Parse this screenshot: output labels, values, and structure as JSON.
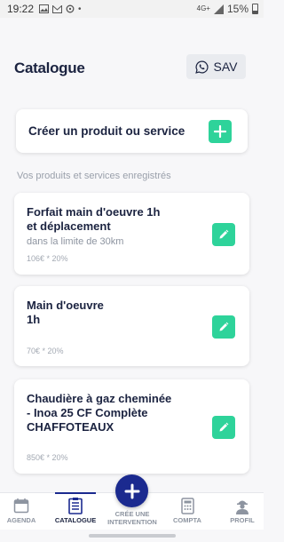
{
  "status_bar": {
    "time": "19:22",
    "network": "4G+",
    "battery": "15%"
  },
  "header": {
    "title": "Catalogue",
    "sav_label": "SAV"
  },
  "create": {
    "label": "Créer un produit ou service"
  },
  "section_label": "Vos produits et services enregistrés",
  "products": [
    {
      "name": "Forfait main d'oeuvre 1h\net déplacement",
      "description": "dans la limite de 30km",
      "price": "106€ * 20%"
    },
    {
      "name": "Main d'oeuvre\n1h",
      "description": "",
      "price": "70€ * 20%"
    },
    {
      "name": "Chaudière à gaz cheminée\n- Inoa 25 CF Complète\nCHAFFOTEAUX",
      "description": "",
      "price": "850€ * 20%"
    }
  ],
  "nav": {
    "agenda": "AGENDA",
    "catalogue": "CATALOGUE",
    "create_intervention": "CRÉE UNE\nINTERVENTION",
    "compta": "COMPTA",
    "profil": "PROFIL"
  },
  "colors": {
    "accent_green": "#2ed39a",
    "primary_navy": "#1b2a8f",
    "text_dark": "#1b2340"
  }
}
